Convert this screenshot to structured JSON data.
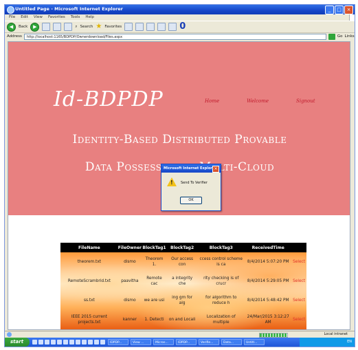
{
  "window": {
    "title": "Untitled Page - Microsoft Internet Explorer",
    "buttons": [
      "_",
      "□",
      "×"
    ]
  },
  "menubar": [
    "File",
    "Edit",
    "View",
    "Favorites",
    "Tools",
    "Help"
  ],
  "toolbar": {
    "back_label": "Back",
    "search_label": "Search",
    "favorites_label": "Favorites",
    "counter": "0"
  },
  "address": {
    "label": "Address",
    "url": "http://localhost:1165/BDPDP/Ownerdownload/Files.aspx",
    "go_label": "Go",
    "links_label": "Links"
  },
  "page": {
    "logo": "Id-BDPDP",
    "nav": [
      "Home",
      "Welcome",
      "Signout"
    ],
    "tagline_line1": "Identity-Based Distributed Provable",
    "tagline_line2": "Data Possession in Multi-Cloud",
    "table": {
      "headers": [
        "FileName",
        "FileOwner",
        "BlockTag1",
        "BlockTag2",
        "BlockTag3",
        "ReceivedTime",
        ""
      ],
      "rows": [
        [
          "theorem.txt",
          "dismo",
          "Theorem 1.",
          "Our access con",
          "ccess control scheme is ca",
          "8/4/2014 5:07:20 PM",
          "Select"
        ],
        [
          "RemoteScrambrid.txt",
          "paavitha",
          "Remote cac",
          "a integrity che",
          "rity checking is of crucr",
          "8/4/2014 5:29:05 PM",
          "Select"
        ],
        [
          "ss.txt",
          "dismo",
          "we are usi",
          "ing gm for alg",
          "for algorithm to reduce h",
          "8/4/2014 5:48:42 PM",
          "Select"
        ],
        [
          "IEEE 2015 current projects.txt",
          "kanner",
          "1. Detecti",
          "on and Locali",
          "Localization of multiple",
          "24/Mar/2015 3:12:27 AM",
          "Select"
        ]
      ]
    }
  },
  "dialog": {
    "title": "Microsoft Internet Explorer",
    "message": "Send To Verifier",
    "ok_label": "OK"
  },
  "statusbar": {
    "zone": "Local intranet"
  },
  "taskbar": {
    "start_label": "start",
    "tasks": [
      "IDPDP...",
      "View ...",
      "Micros...",
      "IDPDP...",
      "Verifie...",
      "Data...",
      "Untitl..."
    ],
    "tray_icons": "EN"
  }
}
